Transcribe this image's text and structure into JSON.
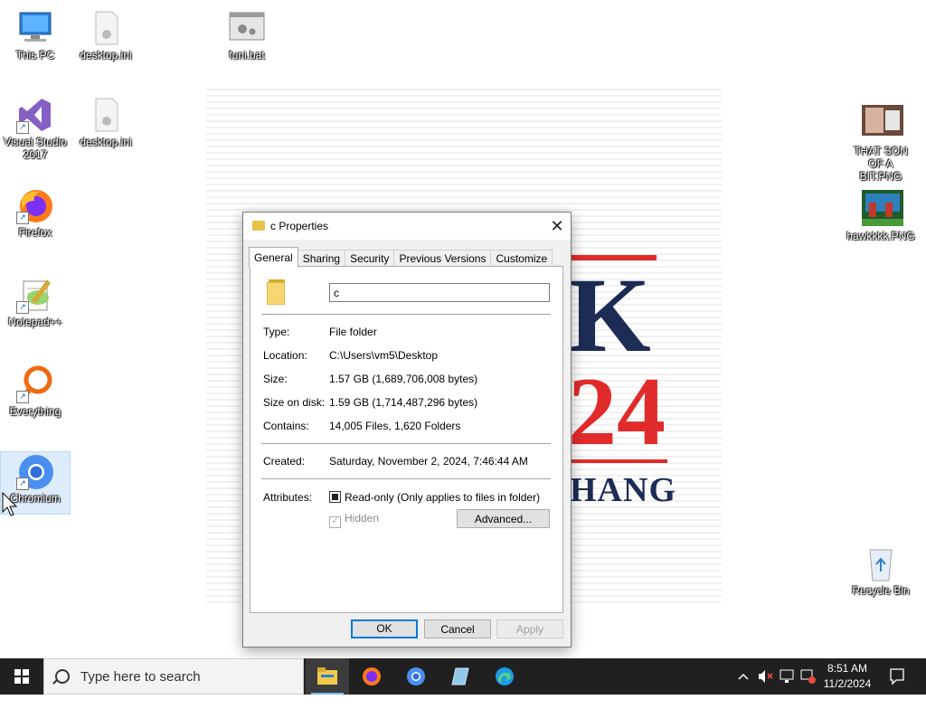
{
  "desktop": {
    "icons": [
      {
        "label": "This PC"
      },
      {
        "label": "desktop.ini"
      },
      {
        "label": "funi.bat"
      },
      {
        "label": "Visual Studio 2017"
      },
      {
        "label": "desktop.ini"
      },
      {
        "label": "Firefox"
      },
      {
        "label": "Notepad++"
      },
      {
        "label": "Everything"
      },
      {
        "label": "Chromium"
      },
      {
        "label": "THAT SON OF A BIT.PNG"
      },
      {
        "label": "hawkkkk.PNG"
      },
      {
        "label": "Recycle Bin"
      }
    ],
    "wallpaper": {
      "line1": "K",
      "line2": "24",
      "line3": "HANG"
    }
  },
  "dialog": {
    "title": "c Properties",
    "close_glyph": "✕",
    "tabs": [
      {
        "label": "General",
        "active": true
      },
      {
        "label": "Sharing"
      },
      {
        "label": "Security"
      },
      {
        "label": "Previous Versions"
      },
      {
        "label": "Customize"
      }
    ],
    "name_value": "c",
    "props": {
      "type": {
        "label": "Type:",
        "value": "File folder"
      },
      "location": {
        "label": "Location:",
        "value": "C:\\Users\\vm5\\Desktop"
      },
      "size": {
        "label": "Size:",
        "value": "1.57 GB (1,689,706,008 bytes)"
      },
      "size_on_disk": {
        "label": "Size on disk:",
        "value": "1.59 GB (1,714,487,296 bytes)"
      },
      "contains": {
        "label": "Contains:",
        "value": "14,005 Files, 1,620 Folders"
      },
      "created": {
        "label": "Created:",
        "value": "Saturday, November 2, 2024, 7:46:44 AM"
      }
    },
    "attributes": {
      "label": "Attributes:",
      "readonly": "Read-only (Only applies to files in folder)",
      "hidden": "Hidden",
      "advanced": "Advanced..."
    },
    "buttons": {
      "ok": "OK",
      "cancel": "Cancel",
      "apply": "Apply"
    }
  },
  "taskbar": {
    "search_placeholder": "Type here to search",
    "clock_time": "8:51 AM",
    "clock_date": "11/2/2024"
  },
  "colors": {
    "accent": "#0078d7",
    "taskbar": "#202020",
    "folder": "#f7d774"
  }
}
